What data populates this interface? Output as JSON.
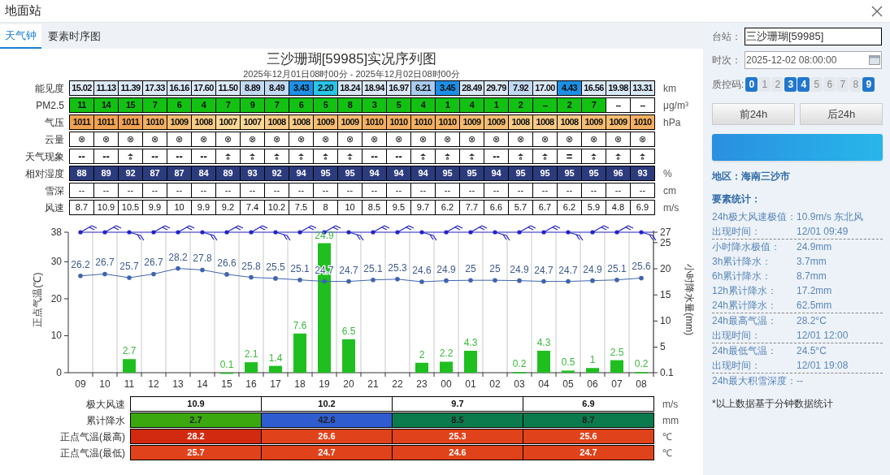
{
  "window": {
    "title": "地面站"
  },
  "tabs": [
    {
      "label": "天气钟",
      "selected": true
    },
    {
      "label": "要素时序图",
      "selected": false
    }
  ],
  "chart_title": "三沙珊瑚[59985]实况序列图",
  "chart_subtitle": "2025年12月01日08时00分 - 2025年12月02日08时00分",
  "rows": [
    {
      "label": "能见度",
      "unit": "km",
      "kind": "colored",
      "cells": [
        {
          "text": "15.02",
          "color": "#e3eefa"
        },
        {
          "text": "11.13",
          "color": "#dbe8f8"
        },
        {
          "text": "11.39",
          "color": "#dbe8f8"
        },
        {
          "text": "17.33",
          "color": "#dbe8f8"
        },
        {
          "text": "16.16",
          "color": "#dbe8f8"
        },
        {
          "text": "17.60",
          "color": "#dbe8f8"
        },
        {
          "text": "11.50",
          "color": "#dbe8f8"
        },
        {
          "text": "8.89",
          "color": "#c3d9f3"
        },
        {
          "text": "8.49",
          "color": "#c3d9f3"
        },
        {
          "text": "3.43",
          "color": "#1e8fe6"
        },
        {
          "text": "2.20",
          "color": "#27c6e9"
        },
        {
          "text": "18.24",
          "color": "#dbe8f8"
        },
        {
          "text": "18.94",
          "color": "#dbe8f8"
        },
        {
          "text": "16.97",
          "color": "#dbe8f8"
        },
        {
          "text": "6.21",
          "color": "#aacbef"
        },
        {
          "text": "3.45",
          "color": "#1e8fe6"
        },
        {
          "text": "28.49",
          "color": "#dbe8f8"
        },
        {
          "text": "29.79",
          "color": "#dbe8f8"
        },
        {
          "text": "7.92",
          "color": "#c3d9f3"
        },
        {
          "text": "17.00",
          "color": "#dbe8f8"
        },
        {
          "text": "4.43",
          "color": "#1e8fe6"
        },
        {
          "text": "16.56",
          "color": "#dbe8f8"
        },
        {
          "text": "19.98",
          "color": "#dbe8f8"
        },
        {
          "text": "13.31",
          "color": "#dbe8f8"
        }
      ]
    },
    {
      "label": "PM2.5",
      "unit": "μg/m³",
      "kind": "colored",
      "cells": [
        {
          "text": "11",
          "color": "#13c113"
        },
        {
          "text": "14",
          "color": "#13c113"
        },
        {
          "text": "15",
          "color": "#13c113"
        },
        {
          "text": "7",
          "color": "#13c113"
        },
        {
          "text": "6",
          "color": "#13c113"
        },
        {
          "text": "4",
          "color": "#13c113"
        },
        {
          "text": "7",
          "color": "#13c113"
        },
        {
          "text": "9",
          "color": "#13c113"
        },
        {
          "text": "7",
          "color": "#13c113"
        },
        {
          "text": "6",
          "color": "#13c113"
        },
        {
          "text": "5",
          "color": "#13c113"
        },
        {
          "text": "8",
          "color": "#13c113"
        },
        {
          "text": "3",
          "color": "#13c113"
        },
        {
          "text": "5",
          "color": "#13c113"
        },
        {
          "text": "4",
          "color": "#13c113"
        },
        {
          "text": "1",
          "color": "#13c113"
        },
        {
          "text": "4",
          "color": "#13c113"
        },
        {
          "text": "1",
          "color": "#13c113"
        },
        {
          "text": "2",
          "color": "#13c113"
        },
        {
          "text": "--",
          "color": "#13c113"
        },
        {
          "text": "2",
          "color": "#13c113"
        },
        {
          "text": "7",
          "color": "#13c113"
        },
        {
          "text": "--",
          "color": "#ffffff"
        },
        {
          "text": "--",
          "color": "#ffffff"
        }
      ]
    },
    {
      "label": "气压",
      "unit": "hPa",
      "kind": "colored",
      "cells": [
        {
          "text": "1011",
          "color": "#f0a252"
        },
        {
          "text": "1011",
          "color": "#f0a252"
        },
        {
          "text": "1011",
          "color": "#f0a252"
        },
        {
          "text": "1010",
          "color": "#f3b062"
        },
        {
          "text": "1009",
          "color": "#f6bd72"
        },
        {
          "text": "1008",
          "color": "#f9cb86"
        },
        {
          "text": "1007",
          "color": "#fbd898"
        },
        {
          "text": "1007",
          "color": "#fbd898"
        },
        {
          "text": "1008",
          "color": "#f9cb86"
        },
        {
          "text": "1008",
          "color": "#f9cb86"
        },
        {
          "text": "1009",
          "color": "#f6bd72"
        },
        {
          "text": "1009",
          "color": "#f6bd72"
        },
        {
          "text": "1010",
          "color": "#f3b062"
        },
        {
          "text": "1010",
          "color": "#f3b062"
        },
        {
          "text": "1010",
          "color": "#f3b062"
        },
        {
          "text": "1010",
          "color": "#f3b062"
        },
        {
          "text": "1009",
          "color": "#f6bd72"
        },
        {
          "text": "1009",
          "color": "#f6bd72"
        },
        {
          "text": "1008",
          "color": "#f9cb86"
        },
        {
          "text": "1008",
          "color": "#f9cb86"
        },
        {
          "text": "1008",
          "color": "#f9cb86"
        },
        {
          "text": "1009",
          "color": "#f6bd72"
        },
        {
          "text": "1009",
          "color": "#f6bd72"
        },
        {
          "text": "1010",
          "color": "#f3b062"
        }
      ]
    },
    {
      "label": "云量",
      "kind": "plain",
      "cells": [
        "⊗",
        "⊗",
        "⊗",
        "⊗",
        "⊗",
        "⊗",
        "⊗",
        "⊗",
        "⊗",
        "⊗",
        "⊗",
        "⊗",
        "⊗",
        "⊗",
        "⊗",
        "⊗",
        "⊗",
        "⊗",
        "⊗",
        "⊗",
        "⊗",
        "⊗",
        "⊗",
        "⊗"
      ]
    },
    {
      "label": "天气现象",
      "kind": "weather",
      "cells": [
        {
          "kind": "text",
          "text": "--"
        },
        {
          "kind": "text",
          "text": "--"
        },
        {
          "kind": "shower"
        },
        {
          "kind": "text",
          "text": "--"
        },
        {
          "kind": "text",
          "text": "--"
        },
        {
          "kind": "text",
          "text": "--"
        },
        {
          "kind": "shower"
        },
        {
          "kind": "shower"
        },
        {
          "kind": "shower"
        },
        {
          "kind": "shower"
        },
        {
          "kind": "shower"
        },
        {
          "kind": "shower"
        },
        {
          "kind": "text",
          "text": "--"
        },
        {
          "kind": "text",
          "text": "--"
        },
        {
          "kind": "shower"
        },
        {
          "kind": "shower"
        },
        {
          "kind": "shower"
        },
        {
          "kind": "text",
          "text": "--"
        },
        {
          "kind": "shower"
        },
        {
          "kind": "shower"
        },
        {
          "kind": "text",
          "text": "="
        },
        {
          "kind": "shower"
        },
        {
          "kind": "shower"
        },
        {
          "kind": "shower"
        }
      ]
    },
    {
      "label": "相对湿度",
      "unit": "%",
      "kind": "dark",
      "cells": [
        "88",
        "89",
        "92",
        "87",
        "87",
        "84",
        "89",
        "93",
        "92",
        "94",
        "95",
        "95",
        "94",
        "94",
        "94",
        "95",
        "95",
        "94",
        "95",
        "95",
        "95",
        "95",
        "96",
        "93"
      ]
    },
    {
      "label": "雪深",
      "unit": "cm",
      "kind": "plain",
      "cells": [
        "--",
        "--",
        "--",
        "--",
        "--",
        "--",
        "--",
        "--",
        "--",
        "--",
        "--",
        "--",
        "--",
        "--",
        "--",
        "--",
        "--",
        "--",
        "--",
        "--",
        "--",
        "--",
        "--",
        "--"
      ]
    },
    {
      "label": "风速",
      "unit": "m/s",
      "kind": "plain",
      "cells": [
        "8.7",
        "10.9",
        "10.5",
        "9.9",
        "10",
        "9.9",
        "9.2",
        "7.4",
        "10.2",
        "7.5",
        "8",
        "10",
        "8.5",
        "9.5",
        "9.7",
        "6.2",
        "7.7",
        "6.6",
        "5.7",
        "6.7",
        "6.2",
        "5.9",
        "4.8",
        "6.9"
      ]
    }
  ],
  "temperature_chart": {
    "chart_data": {
      "type": "line",
      "ylabel": "正点气温(℃)",
      "ylim": [
        0,
        38
      ],
      "yticks": [
        0,
        10,
        20,
        30,
        38
      ],
      "series": [
        {
          "color": "#3e64b0",
          "values": [
            26.2,
            26.7,
            25.7,
            26.7,
            28.2,
            27.8,
            26.6,
            25.8,
            25.5,
            25.1,
            24.7,
            24.7,
            25.1,
            25.3,
            24.6,
            24.9,
            25,
            25,
            24.9,
            24.7,
            24.7,
            24.9,
            25.1,
            25.6
          ]
        }
      ],
      "data_labels": true
    }
  },
  "precipitation_chart": {
    "chart_data": {
      "type": "bar",
      "ylabel": "小时降水量(mm)",
      "categories": [
        "09",
        "10",
        "11",
        "12",
        "13",
        "14",
        "15",
        "16",
        "17",
        "18",
        "19",
        "20",
        "21",
        "22",
        "23",
        "00",
        "01",
        "02",
        "03",
        "04",
        "05",
        "06",
        "07",
        "08"
      ],
      "ylim": [
        0.1,
        27
      ],
      "yticks": [
        0.1,
        5,
        10,
        15,
        20,
        25,
        27
      ],
      "series": [
        {
          "color": "#1fbf1f",
          "values": [
            null,
            null,
            2.7,
            null,
            null,
            null,
            0.1,
            2.1,
            1.4,
            7.6,
            24.9,
            6.5,
            null,
            null,
            2,
            2.2,
            4.3,
            null,
            0.2,
            4.3,
            0.5,
            1,
            2.5,
            0.2
          ]
        }
      ],
      "data_labels": true
    }
  },
  "summary": [
    {
      "label": "极大风速",
      "unit": "m/s",
      "cells": [
        {
          "text": "10.9",
          "color": "#ffffff"
        },
        {
          "text": "10.2",
          "color": "#ffffff"
        },
        {
          "text": "9.7",
          "color": "#ffffff"
        },
        {
          "text": "6.9",
          "color": "#ffffff"
        }
      ]
    },
    {
      "label": "累计降水",
      "unit": "mm",
      "cells": [
        {
          "text": "2.7",
          "color": "#3aa80e"
        },
        {
          "text": "42.6",
          "color": "#2f5ccf"
        },
        {
          "text": "8.5",
          "color": "#0b7a4c"
        },
        {
          "text": "8.7",
          "color": "#0b7a4c"
        }
      ]
    },
    {
      "label": "正点气温(最高)",
      "unit": "℃",
      "cells": [
        {
          "text": "28.2",
          "color": "#d22a10"
        },
        {
          "text": "26.6",
          "color": "#e0421b"
        },
        {
          "text": "25.3",
          "color": "#e0421b"
        },
        {
          "text": "25.6",
          "color": "#e0421b"
        }
      ]
    },
    {
      "label": "正点气温(最低)",
      "unit": "℃",
      "cells": [
        {
          "text": "25.7",
          "color": "#e0421b"
        },
        {
          "text": "24.7",
          "color": "#e0421b"
        },
        {
          "text": "24.6",
          "color": "#e0421b"
        },
        {
          "text": "24.7",
          "color": "#e0421b"
        }
      ]
    }
  ],
  "side": {
    "station_label": "台站：",
    "station_value": "三沙珊瑚[59985]",
    "time_label": "时次：",
    "time_value": "2025-12-02 08:00:00",
    "qc_label": "质控码:",
    "qc_codes": [
      {
        "label": "0",
        "selected": true
      },
      {
        "label": "1",
        "selected": false
      },
      {
        "label": "2",
        "selected": false
      },
      {
        "label": "3",
        "selected": true
      },
      {
        "label": "4",
        "selected": true
      },
      {
        "label": "5",
        "selected": false
      },
      {
        "label": "6",
        "selected": false
      },
      {
        "label": "7",
        "selected": false
      },
      {
        "label": "8",
        "selected": false
      },
      {
        "label": "9",
        "selected": true
      }
    ],
    "prev_button": "前24h",
    "next_button": "后24h",
    "region": "地区：海南三沙市",
    "stats_title": "要素统计：",
    "stat_groups": [
      [
        {
          "label": "24h极大风速极值：",
          "value": "10.9m/s 东北风"
        },
        {
          "label": "出现时间：",
          "value": "12/01 09:49"
        }
      ],
      [
        {
          "label": "小时降水极值：",
          "value": "24.9mm"
        },
        {
          "label": "3h累计降水：",
          "value": "3.7mm"
        },
        {
          "label": "6h累计降水：",
          "value": "8.7mm"
        },
        {
          "label": "12h累计降水：",
          "value": "17.2mm"
        },
        {
          "label": "24h累计降水：",
          "value": "62.5mm"
        }
      ],
      [
        {
          "label": "24h最高气温：",
          "value": "28.2°C"
        },
        {
          "label": "出现时间：",
          "value": "12/01 12:00"
        }
      ],
      [
        {
          "label": "24h最低气温：",
          "value": "24.5°C"
        },
        {
          "label": "出现时间：",
          "value": "12/01 19:08"
        }
      ],
      [
        {
          "label": "24h最大积雪深度：",
          "value": "--"
        }
      ]
    ],
    "footnote": "*以上数据基于分钟数据统计"
  }
}
